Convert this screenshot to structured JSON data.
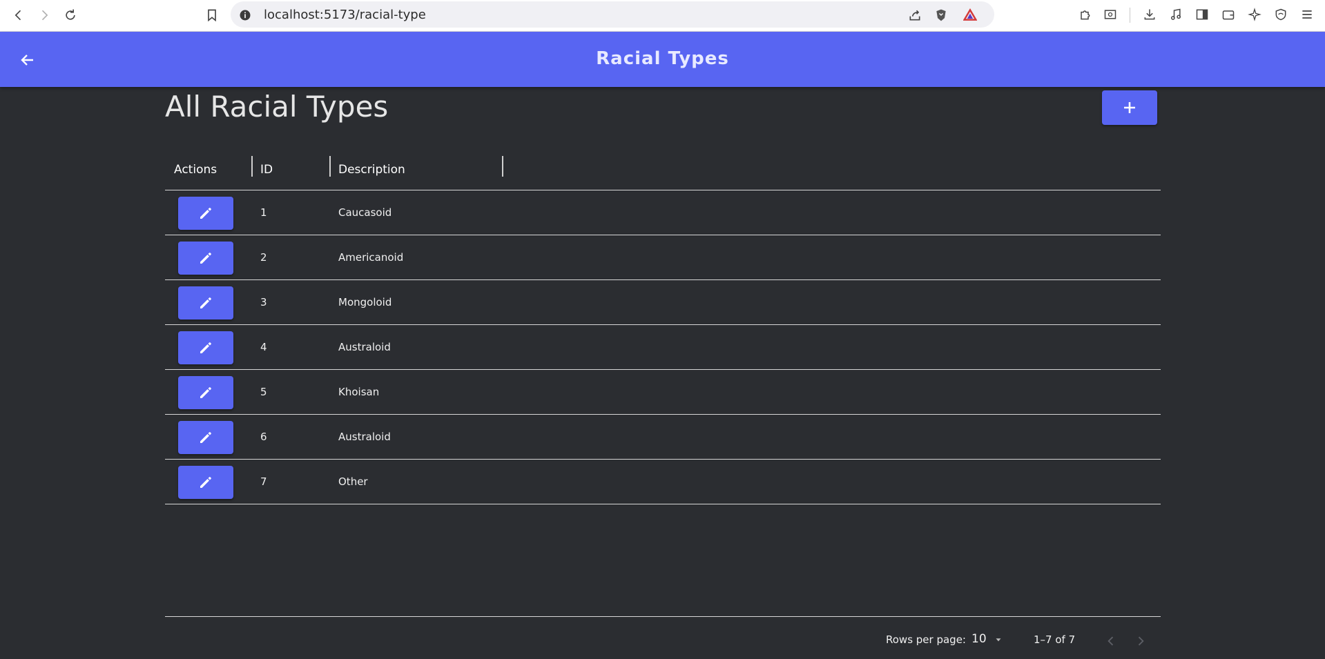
{
  "browser": {
    "url": "localhost:5173/racial-type"
  },
  "app_bar": {
    "title": "Racial Types",
    "accent_color": "#5865f2"
  },
  "page": {
    "heading": "All Racial Types"
  },
  "grid": {
    "columns": [
      "Actions",
      "ID",
      "Description"
    ],
    "rows": [
      {
        "id": "1",
        "description": "Caucasoid"
      },
      {
        "id": "2",
        "description": "Americanoid"
      },
      {
        "id": "3",
        "description": "Mongoloid"
      },
      {
        "id": "4",
        "description": "Australoid"
      },
      {
        "id": "5",
        "description": "Khoisan"
      },
      {
        "id": "6",
        "description": "Australoid"
      },
      {
        "id": "7",
        "description": "Other"
      }
    ]
  },
  "pagination": {
    "rows_per_page_label": "Rows per page:",
    "rows_per_page": "10",
    "range": "1–7 of 7"
  },
  "icons": {
    "back": "arrow-left-icon",
    "add": "plus-icon",
    "edit": "pencil-icon"
  }
}
